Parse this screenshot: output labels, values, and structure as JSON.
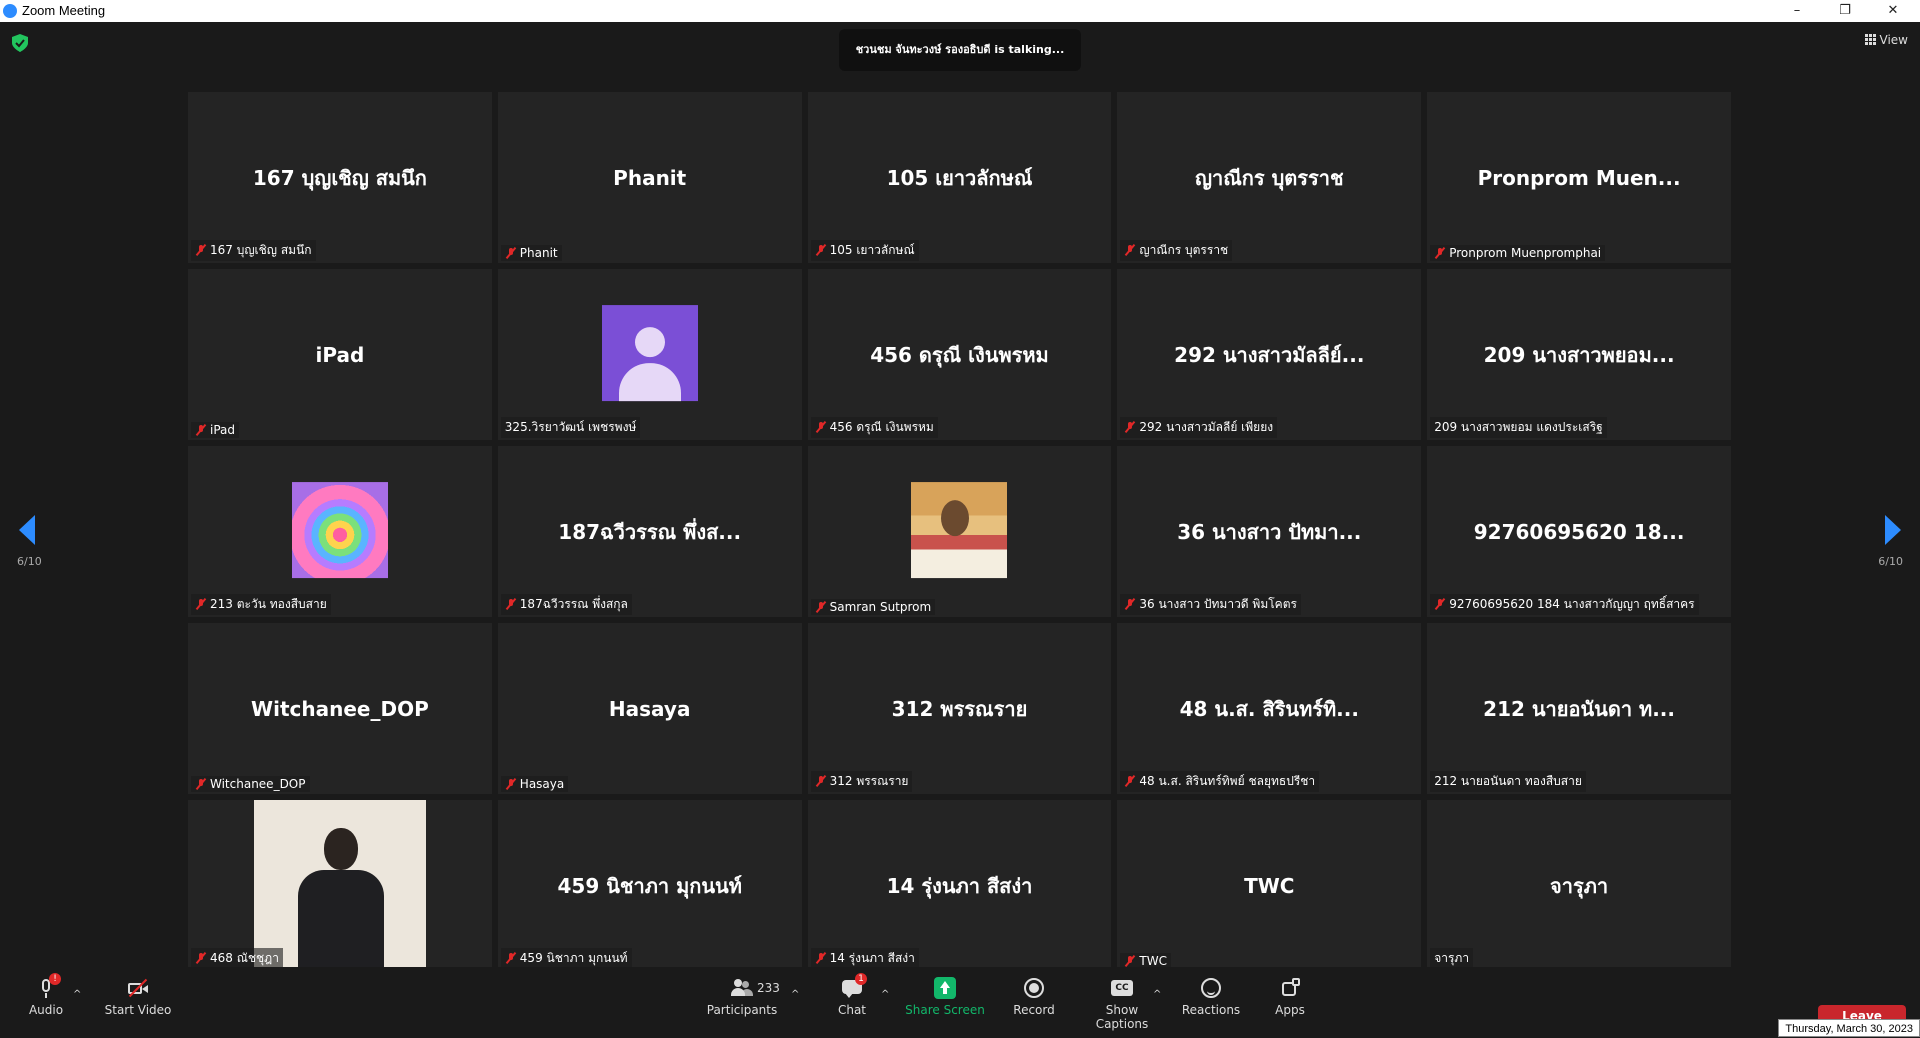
{
  "window": {
    "title": "Zoom Meeting",
    "min": "–",
    "max": "❐",
    "close": "✕"
  },
  "talking": "ชวนชม จันทะวงษ์ รองอธิบดี is talking...",
  "view_label": "View",
  "page": {
    "left": "6/10",
    "right": "6/10"
  },
  "tiles": [
    {
      "name": "167 บุญเชิญ สมนึก",
      "label": "167 บุญเชิญ สมนึก",
      "muted": true,
      "kind": "text"
    },
    {
      "name": "Phanit",
      "label": "Phanit",
      "muted": true,
      "kind": "text"
    },
    {
      "name": "105 เยาวลักษณ์",
      "label": "105 เยาวลักษณ์",
      "muted": true,
      "kind": "text"
    },
    {
      "name": "ญาณีกร บุตรราช",
      "label": "ญาณีกร บุตรราช",
      "muted": true,
      "kind": "text"
    },
    {
      "name": "Pronprom  Muen...",
      "label": "Pronprom Muenpromphai",
      "muted": true,
      "kind": "text"
    },
    {
      "name": "iPad",
      "label": "iPad",
      "muted": true,
      "kind": "text"
    },
    {
      "name": "",
      "label": "325.วิรยาวัฒน์ เพชรพงษ์",
      "muted": false,
      "kind": "avatar"
    },
    {
      "name": "456 ดรุณี เงินพรหม",
      "label": "456 ดรุณี เงินพรหม",
      "muted": true,
      "kind": "text"
    },
    {
      "name": "292 นางสาวมัลลีย์...",
      "label": "292 นางสาวมัลลีย์ เพียยง",
      "muted": true,
      "kind": "text"
    },
    {
      "name": "209 นางสาวพยอม...",
      "label": "209 นางสาวพยอม แดงประเสริฐ",
      "muted": false,
      "kind": "text"
    },
    {
      "name": "",
      "label": "213 ตะวัน ทองสืบสาย",
      "muted": true,
      "kind": "heart"
    },
    {
      "name": "187ฉวีวรรณ พึ่งส...",
      "label": "187ฉวีวรรณ พึ่งสกุล",
      "muted": true,
      "kind": "text"
    },
    {
      "name": "",
      "label": "Samran Sutprom",
      "muted": true,
      "kind": "photo"
    },
    {
      "name": "36 นางสาว ปัทมา...",
      "label": "36 นางสาว ปัทมาวดี พิมโคตร",
      "muted": true,
      "kind": "text"
    },
    {
      "name": "92760695620 18...",
      "label": "92760695620 184 นางสาวกัญญา ฤทธิ์สาคร",
      "muted": true,
      "kind": "text"
    },
    {
      "name": "Witchanee_DOP",
      "label": "Witchanee_DOP",
      "muted": true,
      "kind": "text"
    },
    {
      "name": "Hasaya",
      "label": "Hasaya",
      "muted": true,
      "kind": "text"
    },
    {
      "name": "312 พรรณราย",
      "label": "312 พรรณราย",
      "muted": true,
      "kind": "text"
    },
    {
      "name": "48 น.ส. สิรินทร์ทิ...",
      "label": "48 น.ส. สิรินทร์ทิพย์ ชลยุทธปรีชา",
      "muted": true,
      "kind": "text"
    },
    {
      "name": "212 นายอนันดา ท...",
      "label": "212 นายอนันดา ทองสืบสาย",
      "muted": false,
      "kind": "text"
    },
    {
      "name": "",
      "label": "468 ณัชชุฎา",
      "muted": true,
      "kind": "person"
    },
    {
      "name": "459 นิชาภา มุกนนท์",
      "label": "459 นิชาภา มุกนนท์",
      "muted": true,
      "kind": "text"
    },
    {
      "name": "14 รุ่งนภา สีสง่า",
      "label": "14 รุ่งนภา สีสง่า",
      "muted": true,
      "kind": "text"
    },
    {
      "name": "TWC",
      "label": "TWC",
      "muted": true,
      "kind": "text"
    },
    {
      "name": "จารุภา",
      "label": "จารุภา",
      "muted": false,
      "kind": "text"
    }
  ],
  "toolbar": {
    "audio": "Audio",
    "audio_badge": "!",
    "video": "Start Video",
    "participants": "Participants",
    "participants_count": "233",
    "chat": "Chat",
    "chat_badge": "1",
    "share": "Share Screen",
    "record": "Record",
    "captions": "Show Captions",
    "reactions": "Reactions",
    "apps": "Apps",
    "leave": "Leave",
    "caret": "^"
  },
  "date": "Thursday, March 30, 2023",
  "colors": {
    "accent": "#2d8cff",
    "mute": "#e02828",
    "share": "#12b76a",
    "leave": "#c9262c"
  }
}
